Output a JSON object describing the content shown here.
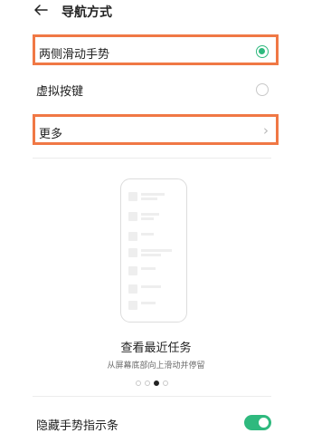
{
  "header": {
    "title": "导航方式",
    "back_icon": "arrow-left-icon"
  },
  "options": [
    {
      "label": "两侧滑动手势",
      "selected": true
    },
    {
      "label": "虚拟按键",
      "selected": false
    }
  ],
  "more": {
    "label": "更多",
    "icon": "chevron-right-icon"
  },
  "preview": {
    "title": "查看最近任务",
    "subtitle": "从屏幕底部向上滑动并停留",
    "page_count": 4,
    "active_page": 3
  },
  "hide_indicator": {
    "label": "隐藏手势指示条",
    "enabled": true
  },
  "colors": {
    "accent": "#2fb97e",
    "highlight": "#f07845"
  }
}
